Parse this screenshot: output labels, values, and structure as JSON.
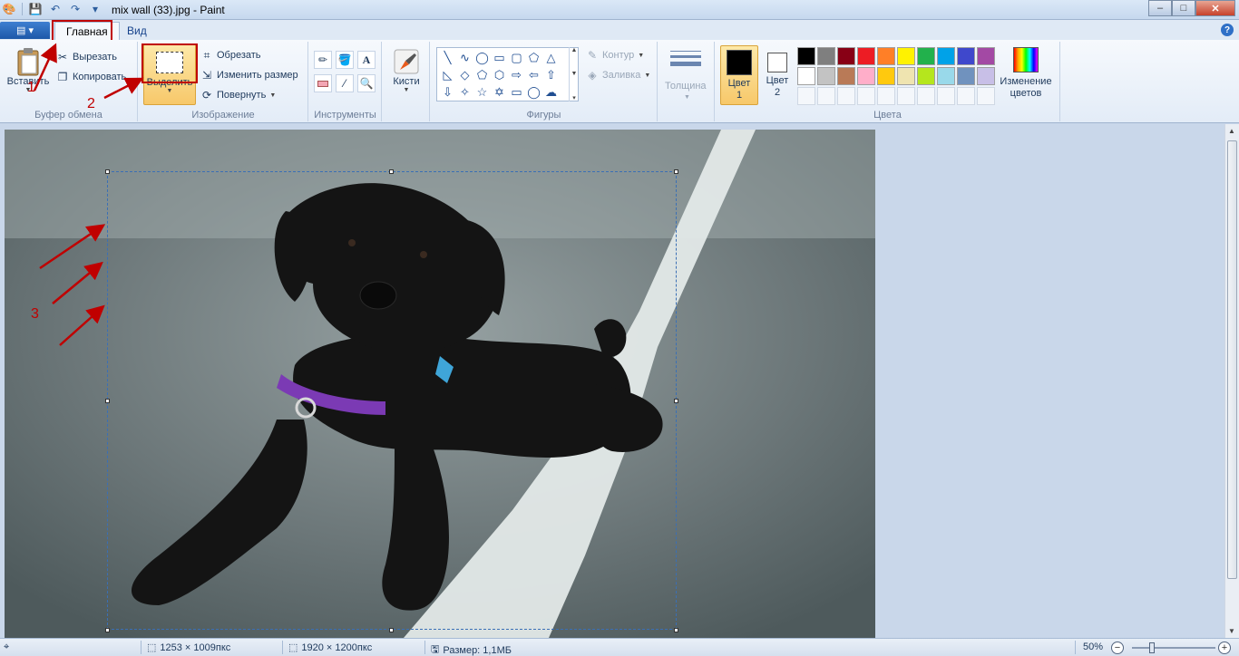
{
  "window": {
    "title": "mix wall (33).jpg - Paint",
    "controls": {
      "minimize": "‒",
      "maximize": "□",
      "close": "✕"
    }
  },
  "tabs": {
    "home": "Главная",
    "view": "Вид",
    "help": "?"
  },
  "clipboard": {
    "paste_label": "Вставить",
    "cut_label": "Вырезать",
    "copy_label": "Копировать",
    "group_label": "Буфер обмена"
  },
  "image": {
    "select_label": "Выделить",
    "crop_label": "Обрезать",
    "resize_label": "Изменить размер",
    "rotate_label": "Повернуть",
    "group_label": "Изображение"
  },
  "tools": {
    "group_label": "Инструменты",
    "text_tool_glyph": "A"
  },
  "brushes": {
    "label": "Кисти"
  },
  "shapes": {
    "outline_label": "Контур",
    "fill_label": "Заливка",
    "group_label": "Фигуры",
    "icons": [
      "line-icon",
      "curve-icon",
      "oval-icon",
      "rectangle-icon",
      "rounded-rect-icon",
      "polygon-icon",
      "triangle-icon",
      "right-triangle-icon",
      "diamond-icon",
      "pentagon-icon",
      "hexagon-icon",
      "right-arrow-icon",
      "left-arrow-icon",
      "up-arrow-icon",
      "down-arrow-icon",
      "star4-icon",
      "star5-icon",
      "star6-icon",
      "callout-rect-icon",
      "callout-oval-icon",
      "callout-cloud-icon"
    ]
  },
  "size": {
    "label": "Толщина"
  },
  "colors": {
    "color1_label_line1": "Цвет",
    "color1_label_line2": "1",
    "color2_label_line1": "Цвет",
    "color2_label_line2": "2",
    "color1_value": "#000000",
    "color2_value": "#ffffff",
    "edit_label_line1": "Изменение",
    "edit_label_line2": "цветов",
    "group_label": "Цвета",
    "palette_row1": [
      "#000000",
      "#7f7f7f",
      "#880015",
      "#ed1c24",
      "#ff7f27",
      "#fff200",
      "#22b14c",
      "#00a2e8",
      "#3f48cc",
      "#a349a4"
    ],
    "palette_row2": [
      "#ffffff",
      "#c3c3c3",
      "#b97a57",
      "#ffaec9",
      "#ffc90e",
      "#efe4b0",
      "#b5e61d",
      "#99d9ea",
      "#7092be",
      "#c8bfe7"
    ]
  },
  "annotations": {
    "n1": "1",
    "n2": "2",
    "n3": "3",
    "color": "#c00000"
  },
  "status": {
    "selection_size": "1253 × 1009пкс",
    "image_size": "1920 × 1200пкс",
    "file_size": "Размер: 1,1МБ",
    "zoom": "50%",
    "zoom_fraction": 0.5
  }
}
